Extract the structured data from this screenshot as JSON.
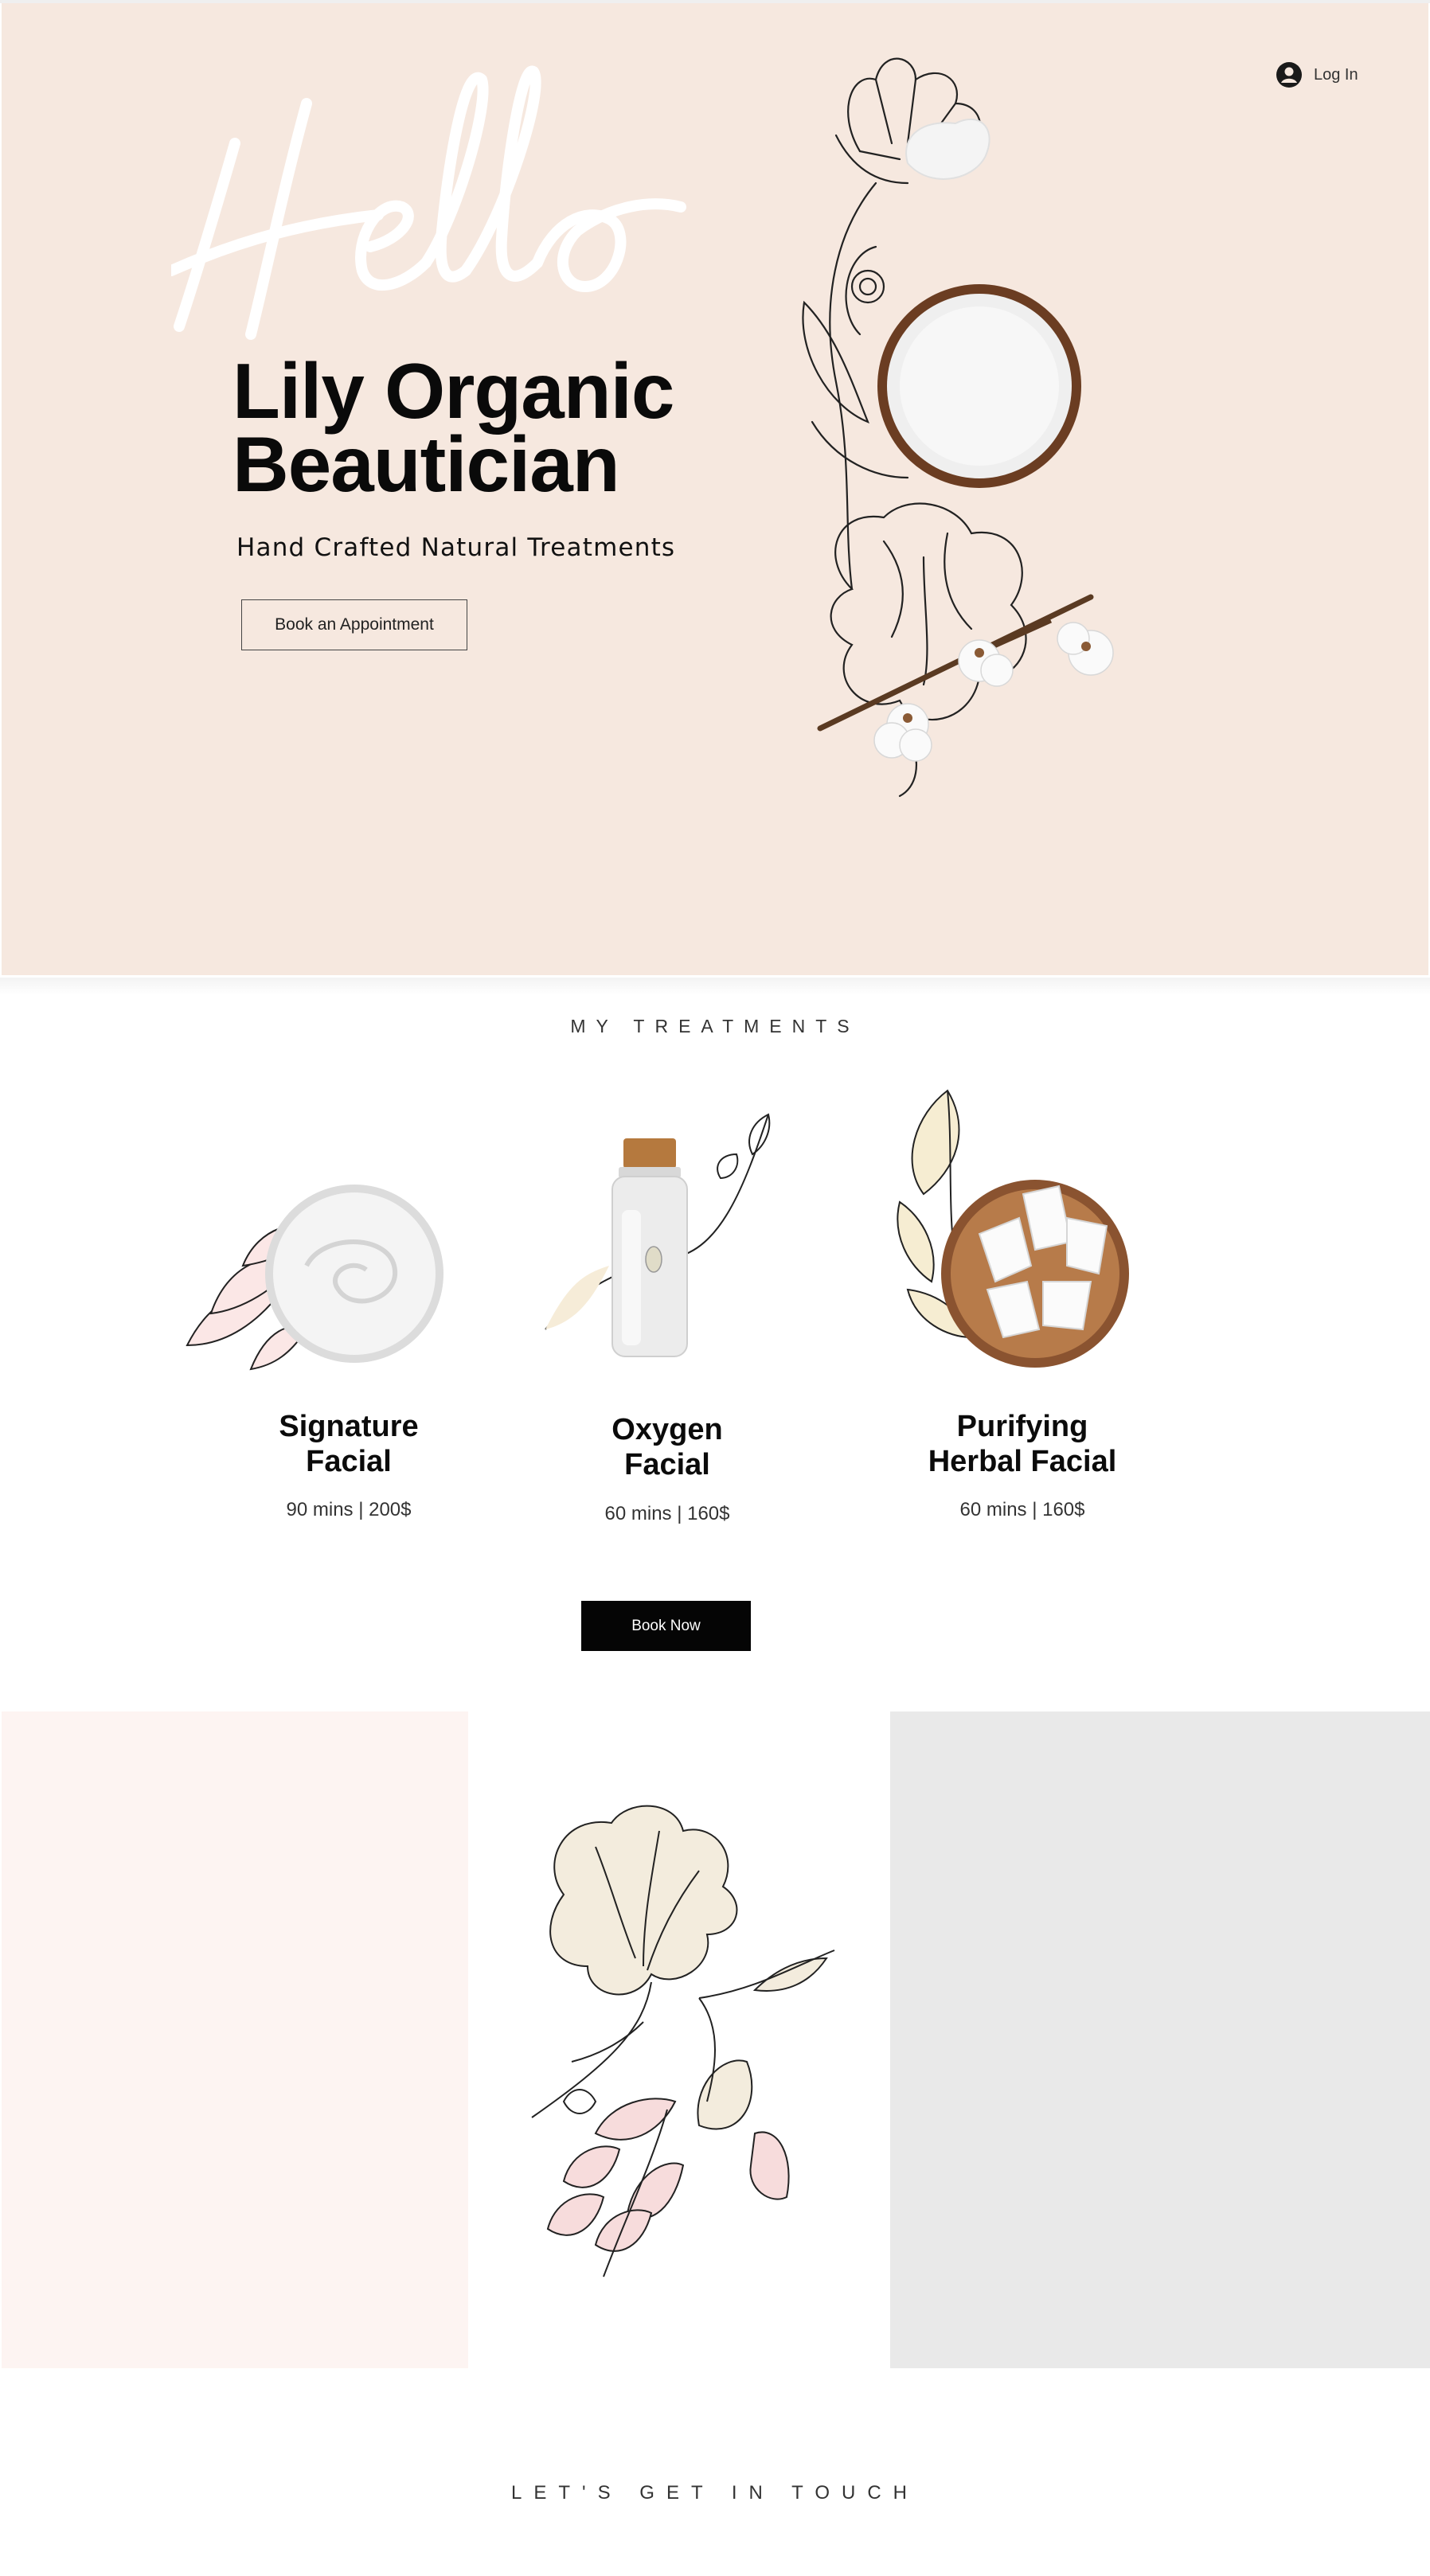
{
  "header": {
    "login_label": "Log In"
  },
  "hero": {
    "script_word": "Hello",
    "title_line1": "Lily Organic",
    "title_line2": "Beautician",
    "subtitle": "Hand Crafted Natural Treatments",
    "cta_label": "Book an Appointment"
  },
  "treatments": {
    "section_title": "MY TREATMENTS",
    "items": [
      {
        "name_line1": "Signature",
        "name_line2": "Facial",
        "details": "90 mins | 200$",
        "icon": "cream-jar-icon"
      },
      {
        "name_line1": "Oxygen",
        "name_line2": "Facial",
        "details": "60 mins | 160$",
        "icon": "oil-bottle-icon"
      },
      {
        "name_line1": "Purifying",
        "name_line2": "Herbal Facial",
        "details": "60 mins | 160$",
        "icon": "coconut-bowl-icon"
      }
    ],
    "book_label": "Book Now"
  },
  "contact": {
    "section_title": "LET'S GET IN TOUCH"
  },
  "colors": {
    "hero_bg": "#f6e8df",
    "pink_panel": "#fdf4f2",
    "grey_panel": "#e9e9e9",
    "button_dark": "#050505"
  }
}
